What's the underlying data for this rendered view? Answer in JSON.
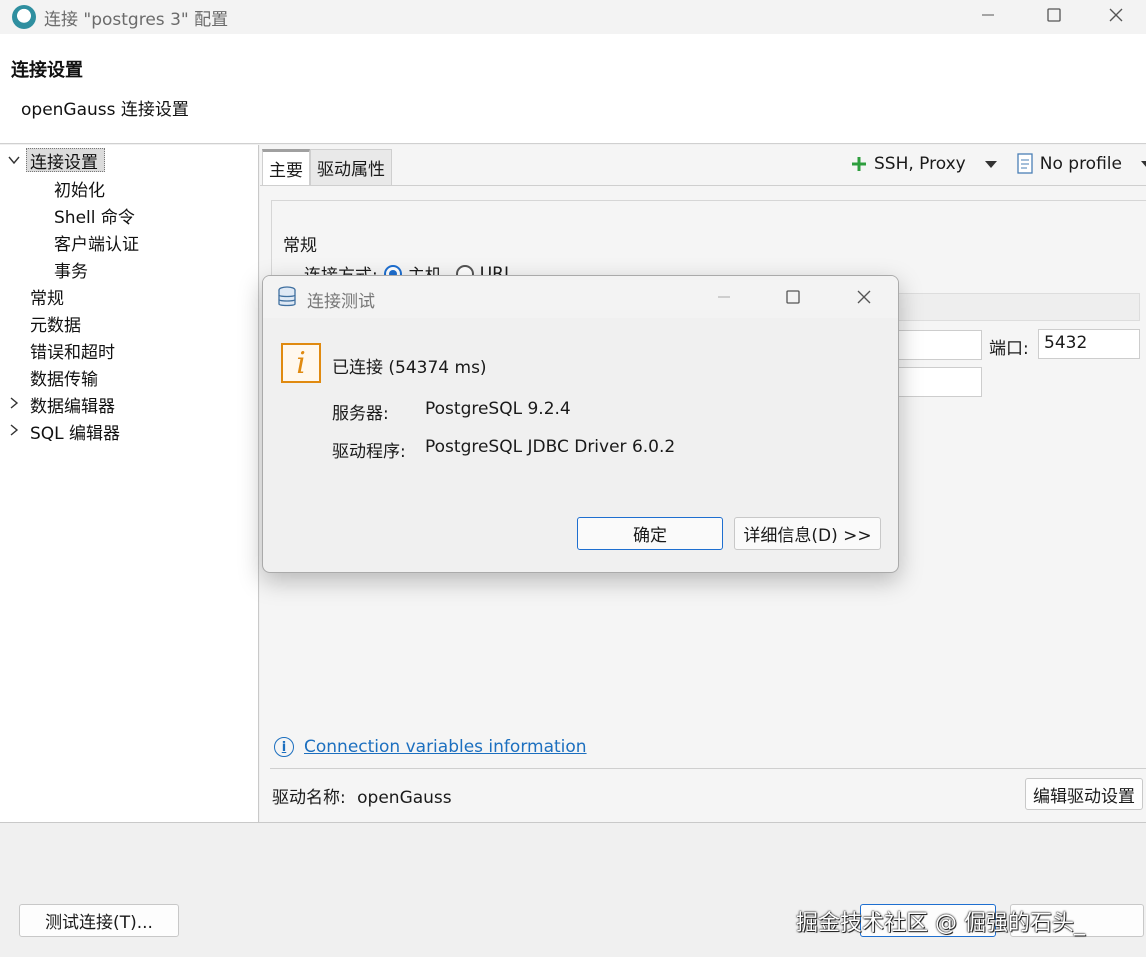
{
  "window": {
    "title": "连接 \"postgres 3\" 配置"
  },
  "header": {
    "title": "连接设置",
    "subtitle": "openGauss 连接设置"
  },
  "tree": {
    "items": [
      {
        "label": "连接设置",
        "expanded": true,
        "selected": true
      },
      {
        "label": "初始化"
      },
      {
        "label": "Shell 命令"
      },
      {
        "label": "客户端认证"
      },
      {
        "label": "事务"
      },
      {
        "label": "常规"
      },
      {
        "label": "元数据"
      },
      {
        "label": "错误和超时"
      },
      {
        "label": "数据传输"
      },
      {
        "label": "数据编辑器",
        "expanded": false
      },
      {
        "label": "SQL 编辑器",
        "expanded": false
      }
    ]
  },
  "tabs": [
    {
      "label": "主要",
      "active": true
    },
    {
      "label": "驱动属性",
      "active": false
    }
  ],
  "toolbar": {
    "ssh_proxy": "SSH, Proxy",
    "profile": "No profile"
  },
  "main": {
    "group_title": "常规",
    "conn_method_label": "连接方式:",
    "radio_host": "主机",
    "radio_url": "URL",
    "port_label": "端口:",
    "port_value": "5432",
    "conn_vars_link": "Connection variables information",
    "driver_name_label": "驱动名称:",
    "driver_name_value": "openGauss",
    "edit_driver_button": "编辑驱动设置"
  },
  "bottom": {
    "test_connection_button": "测试连接(T)...",
    "watermark": "掘金技术社区 @ 倔强的石头_"
  },
  "dialog": {
    "title": "连接测试",
    "message": "已连接 (54374 ms)",
    "server_label": "服务器:",
    "server_value": "PostgreSQL 9.2.4",
    "driver_label": "驱动程序:",
    "driver_value": "PostgreSQL JDBC Driver 6.0.2",
    "ok_button": "确定",
    "details_button": "详细信息(D) >>"
  },
  "colors": {
    "accent": "#1e6fd0",
    "link": "#1c6fbf",
    "info_icon": "#e08a10",
    "add_icon": "#2e9e3e"
  }
}
